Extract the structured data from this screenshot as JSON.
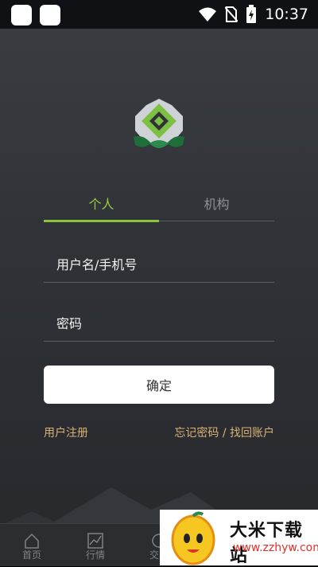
{
  "status_bar": {
    "time": "10:37"
  },
  "tabs": [
    {
      "label": "个人",
      "active": true
    },
    {
      "label": "机构",
      "active": false
    }
  ],
  "form": {
    "username_placeholder": "用户名/手机号",
    "password_placeholder": "密码",
    "confirm_label": "确定"
  },
  "links": {
    "register": "用户注册",
    "forgot": "忘记密码 / 找回账户"
  },
  "bottom_nav": [
    {
      "label": "首页",
      "icon": "home-icon"
    },
    {
      "label": "行情",
      "icon": "chart-icon"
    },
    {
      "label": "交易",
      "icon": "trade-icon"
    }
  ],
  "watermark": {
    "title": "大米下载站",
    "url": "www.zzhyw.com"
  },
  "colors": {
    "accent": "#8fc43a",
    "link": "#d9b274"
  }
}
